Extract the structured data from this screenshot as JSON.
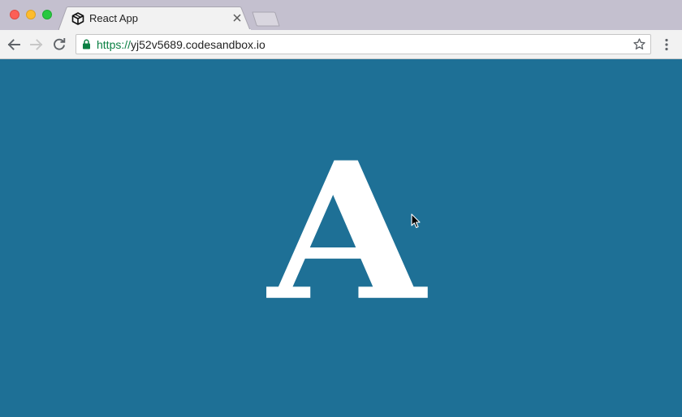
{
  "tab": {
    "title": "React App",
    "favicon": "codesandbox-cube-icon",
    "close_icon": "close-icon"
  },
  "toolbar": {
    "back_icon": "arrow-left-icon",
    "forward_icon": "arrow-right-icon",
    "reload_icon": "reload-icon",
    "bookmark_icon": "star-icon",
    "menu_icon": "more-vertical-icon"
  },
  "address_bar": {
    "scheme": "https://",
    "host": "yj52v5689.codesandbox.io",
    "secure": true
  },
  "content": {
    "display_text": "A",
    "background_color": "#1e7096",
    "text_color": "#ffffff"
  },
  "colors": {
    "tabstrip": "#c4c0cf",
    "toolbar": "#f2f2f2",
    "secure_green": "#0b8043"
  }
}
